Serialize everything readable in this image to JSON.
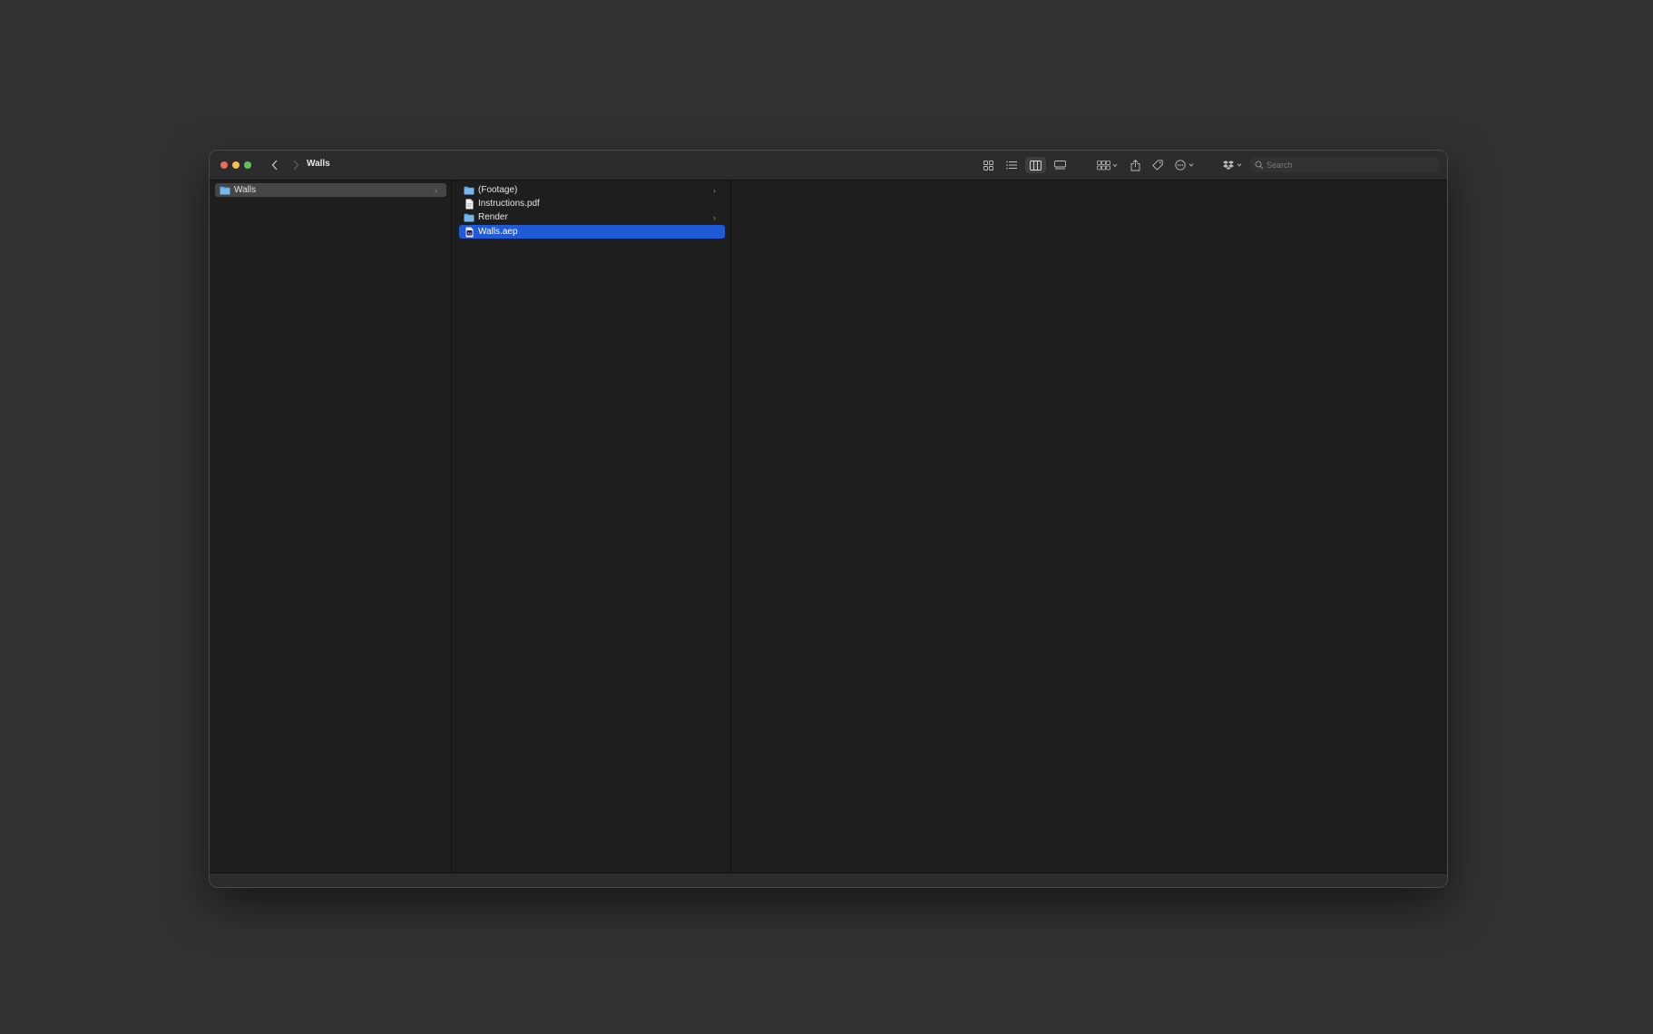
{
  "window": {
    "title": "Walls"
  },
  "toolbar": {
    "back_icon": "chevron-left-icon",
    "forward_icon": "chevron-right-icon",
    "view_modes": [
      "icon-view",
      "list-view",
      "column-view",
      "gallery-view"
    ],
    "active_view": "column-view",
    "group_icon": "group-by-icon",
    "share_icon": "share-icon",
    "tag_icon": "tag-icon",
    "action_icon": "more-actions-icon",
    "dropbox_icon": "dropbox-icon"
  },
  "search": {
    "placeholder": "Search"
  },
  "columns": {
    "col1": {
      "items": [
        {
          "label": "Walls",
          "type": "folder",
          "has_children": true,
          "selected": "inactive"
        }
      ]
    },
    "col2": {
      "items": [
        {
          "label": "(Footage)",
          "type": "folder",
          "has_children": true
        },
        {
          "label": "Instructions.pdf",
          "type": "pdf"
        },
        {
          "label": "Render",
          "type": "folder",
          "has_children": true
        },
        {
          "label": "Walls.aep",
          "type": "aep",
          "selected": "active"
        }
      ]
    }
  },
  "colors": {
    "selection_active": "#1f5bd6",
    "selection_inactive": "#464646",
    "folder": "#5ea9e9"
  }
}
